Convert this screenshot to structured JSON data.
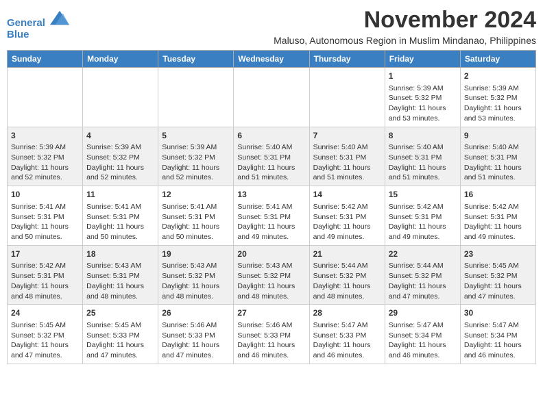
{
  "header": {
    "logo_line1": "General",
    "logo_line2": "Blue",
    "month": "November 2024",
    "subtitle": "Maluso, Autonomous Region in Muslim Mindanao, Philippines"
  },
  "weekdays": [
    "Sunday",
    "Monday",
    "Tuesday",
    "Wednesday",
    "Thursday",
    "Friday",
    "Saturday"
  ],
  "weeks": [
    [
      {
        "day": "",
        "info": ""
      },
      {
        "day": "",
        "info": ""
      },
      {
        "day": "",
        "info": ""
      },
      {
        "day": "",
        "info": ""
      },
      {
        "day": "",
        "info": ""
      },
      {
        "day": "1",
        "info": "Sunrise: 5:39 AM\nSunset: 5:32 PM\nDaylight: 11 hours\nand 53 minutes."
      },
      {
        "day": "2",
        "info": "Sunrise: 5:39 AM\nSunset: 5:32 PM\nDaylight: 11 hours\nand 53 minutes."
      }
    ],
    [
      {
        "day": "3",
        "info": "Sunrise: 5:39 AM\nSunset: 5:32 PM\nDaylight: 11 hours\nand 52 minutes."
      },
      {
        "day": "4",
        "info": "Sunrise: 5:39 AM\nSunset: 5:32 PM\nDaylight: 11 hours\nand 52 minutes."
      },
      {
        "day": "5",
        "info": "Sunrise: 5:39 AM\nSunset: 5:32 PM\nDaylight: 11 hours\nand 52 minutes."
      },
      {
        "day": "6",
        "info": "Sunrise: 5:40 AM\nSunset: 5:31 PM\nDaylight: 11 hours\nand 51 minutes."
      },
      {
        "day": "7",
        "info": "Sunrise: 5:40 AM\nSunset: 5:31 PM\nDaylight: 11 hours\nand 51 minutes."
      },
      {
        "day": "8",
        "info": "Sunrise: 5:40 AM\nSunset: 5:31 PM\nDaylight: 11 hours\nand 51 minutes."
      },
      {
        "day": "9",
        "info": "Sunrise: 5:40 AM\nSunset: 5:31 PM\nDaylight: 11 hours\nand 51 minutes."
      }
    ],
    [
      {
        "day": "10",
        "info": "Sunrise: 5:41 AM\nSunset: 5:31 PM\nDaylight: 11 hours\nand 50 minutes."
      },
      {
        "day": "11",
        "info": "Sunrise: 5:41 AM\nSunset: 5:31 PM\nDaylight: 11 hours\nand 50 minutes."
      },
      {
        "day": "12",
        "info": "Sunrise: 5:41 AM\nSunset: 5:31 PM\nDaylight: 11 hours\nand 50 minutes."
      },
      {
        "day": "13",
        "info": "Sunrise: 5:41 AM\nSunset: 5:31 PM\nDaylight: 11 hours\nand 49 minutes."
      },
      {
        "day": "14",
        "info": "Sunrise: 5:42 AM\nSunset: 5:31 PM\nDaylight: 11 hours\nand 49 minutes."
      },
      {
        "day": "15",
        "info": "Sunrise: 5:42 AM\nSunset: 5:31 PM\nDaylight: 11 hours\nand 49 minutes."
      },
      {
        "day": "16",
        "info": "Sunrise: 5:42 AM\nSunset: 5:31 PM\nDaylight: 11 hours\nand 49 minutes."
      }
    ],
    [
      {
        "day": "17",
        "info": "Sunrise: 5:42 AM\nSunset: 5:31 PM\nDaylight: 11 hours\nand 48 minutes."
      },
      {
        "day": "18",
        "info": "Sunrise: 5:43 AM\nSunset: 5:31 PM\nDaylight: 11 hours\nand 48 minutes."
      },
      {
        "day": "19",
        "info": "Sunrise: 5:43 AM\nSunset: 5:32 PM\nDaylight: 11 hours\nand 48 minutes."
      },
      {
        "day": "20",
        "info": "Sunrise: 5:43 AM\nSunset: 5:32 PM\nDaylight: 11 hours\nand 48 minutes."
      },
      {
        "day": "21",
        "info": "Sunrise: 5:44 AM\nSunset: 5:32 PM\nDaylight: 11 hours\nand 48 minutes."
      },
      {
        "day": "22",
        "info": "Sunrise: 5:44 AM\nSunset: 5:32 PM\nDaylight: 11 hours\nand 47 minutes."
      },
      {
        "day": "23",
        "info": "Sunrise: 5:45 AM\nSunset: 5:32 PM\nDaylight: 11 hours\nand 47 minutes."
      }
    ],
    [
      {
        "day": "24",
        "info": "Sunrise: 5:45 AM\nSunset: 5:32 PM\nDaylight: 11 hours\nand 47 minutes."
      },
      {
        "day": "25",
        "info": "Sunrise: 5:45 AM\nSunset: 5:33 PM\nDaylight: 11 hours\nand 47 minutes."
      },
      {
        "day": "26",
        "info": "Sunrise: 5:46 AM\nSunset: 5:33 PM\nDaylight: 11 hours\nand 47 minutes."
      },
      {
        "day": "27",
        "info": "Sunrise: 5:46 AM\nSunset: 5:33 PM\nDaylight: 11 hours\nand 46 minutes."
      },
      {
        "day": "28",
        "info": "Sunrise: 5:47 AM\nSunset: 5:33 PM\nDaylight: 11 hours\nand 46 minutes."
      },
      {
        "day": "29",
        "info": "Sunrise: 5:47 AM\nSunset: 5:34 PM\nDaylight: 11 hours\nand 46 minutes."
      },
      {
        "day": "30",
        "info": "Sunrise: 5:47 AM\nSunset: 5:34 PM\nDaylight: 11 hours\nand 46 minutes."
      }
    ]
  ]
}
